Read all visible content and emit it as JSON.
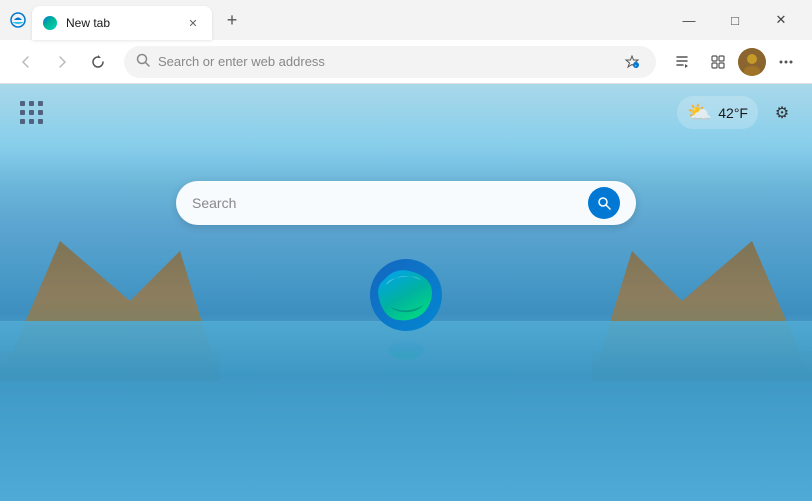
{
  "titleBar": {
    "tab": {
      "label": "New tab",
      "favicon": "edge"
    },
    "newTabButton": "+",
    "windowButtons": {
      "minimize": "—",
      "maximize": "□",
      "close": "✕"
    }
  },
  "toolbar": {
    "back": "←",
    "forward": "→",
    "refresh": "↻",
    "addressBar": {
      "placeholder": "Search or enter web address"
    },
    "favorites": "☆",
    "collections": "⊞",
    "profileAvatar": "👤",
    "more": "···"
  },
  "content": {
    "weather": {
      "temp": "42°F",
      "icon": "⛅"
    },
    "settingsIcon": "⚙",
    "searchPlaceholder": "Search",
    "edgeLogoAlt": "Microsoft Edge Logo"
  }
}
